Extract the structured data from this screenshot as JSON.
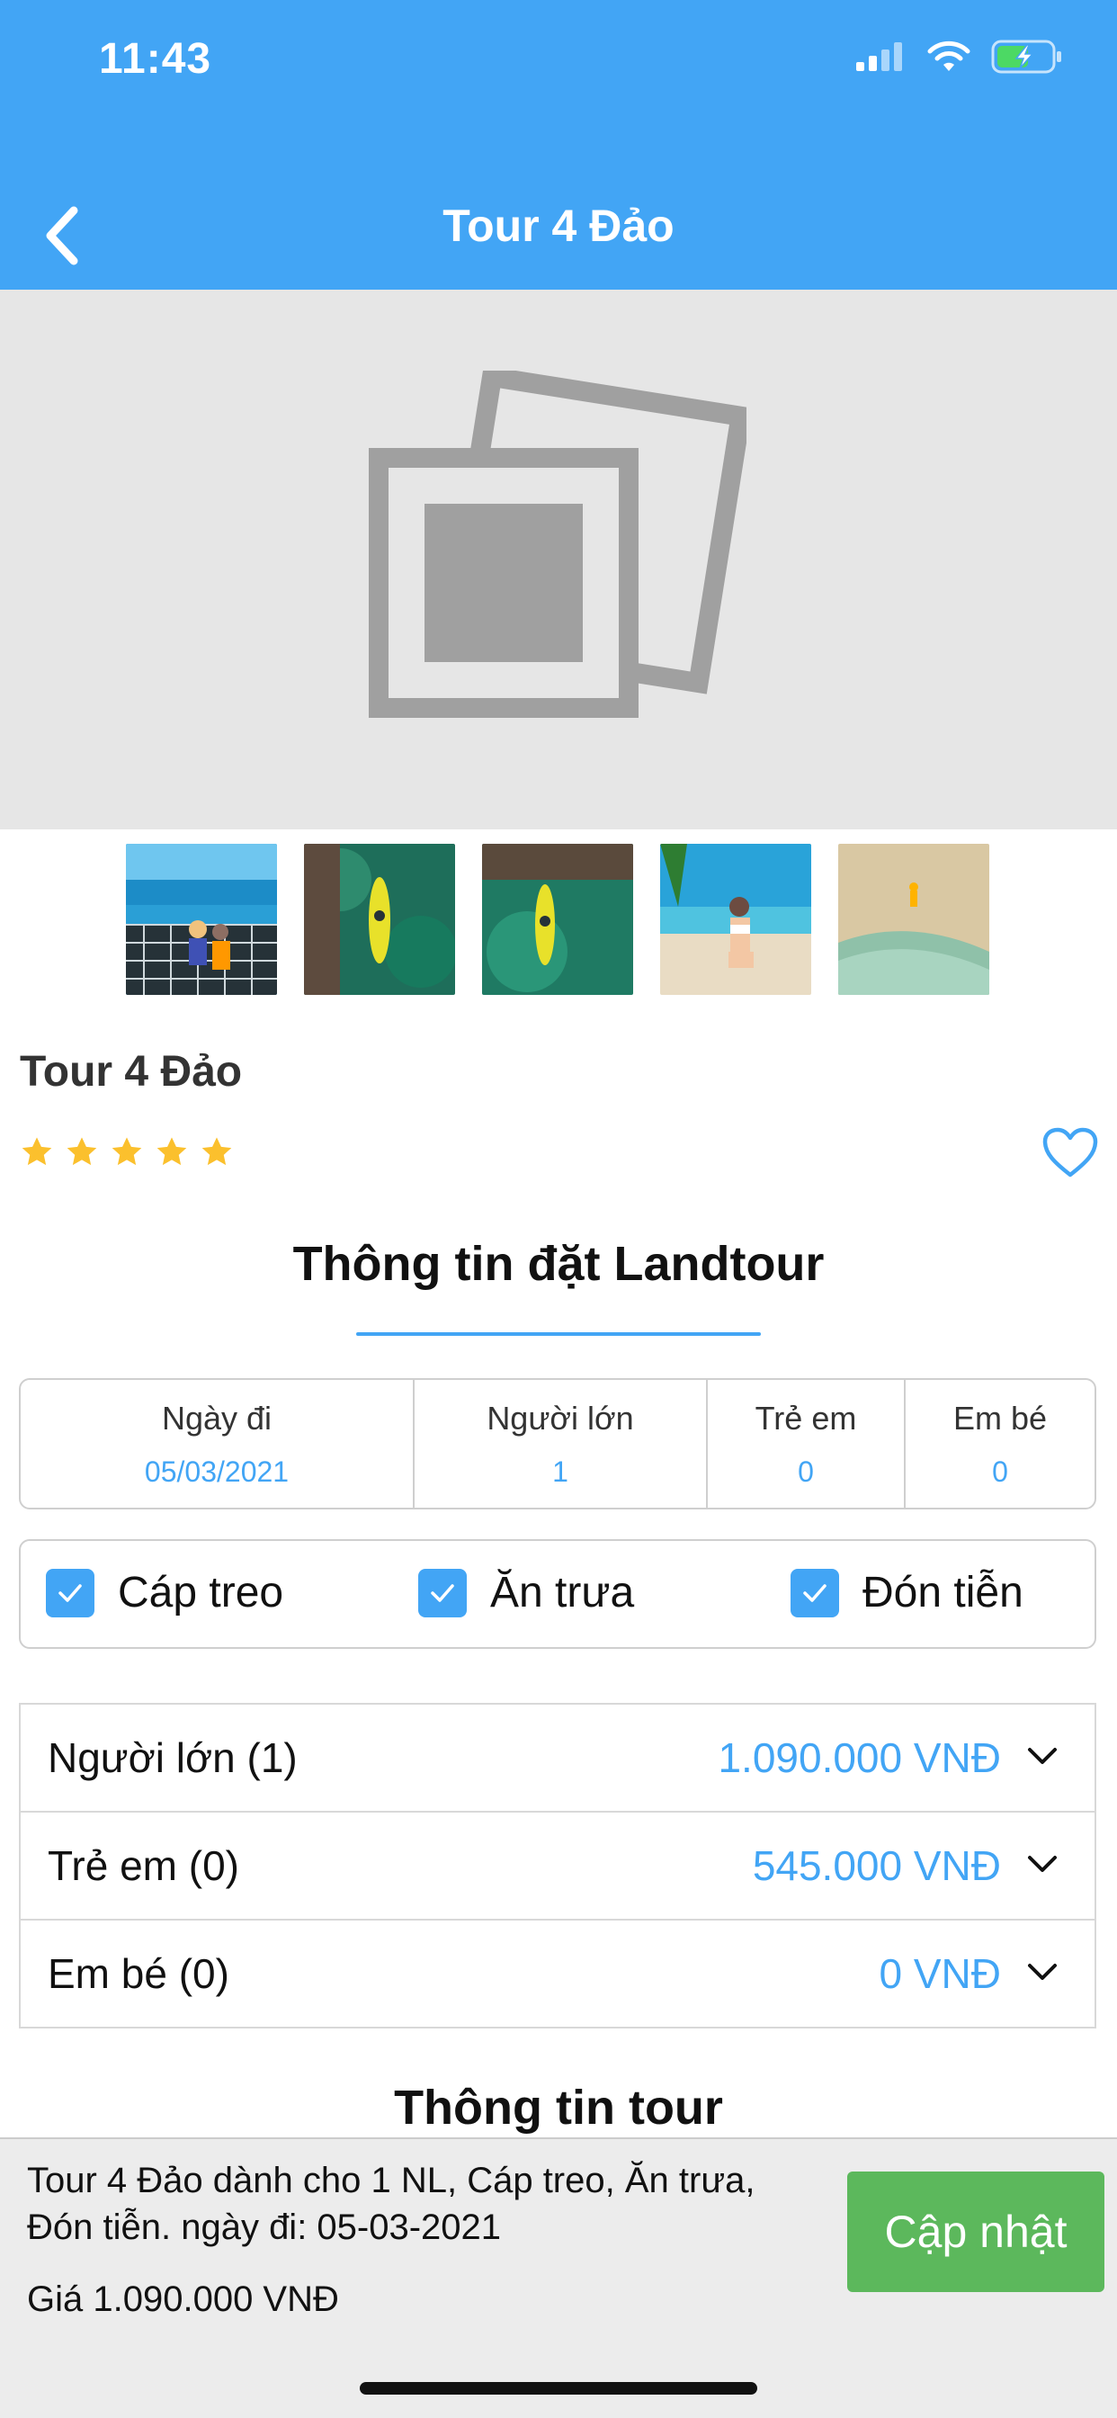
{
  "status_bar": {
    "time": "11:43"
  },
  "header": {
    "title": "Tour 4 Đảo"
  },
  "tour": {
    "name": "Tour 4 Đảo",
    "rating": 5
  },
  "booking": {
    "title": "Thông tin đặt Landtour",
    "fields": [
      {
        "label": "Ngày đi",
        "value": "05/03/2021"
      },
      {
        "label": "Người lớn",
        "value": "1"
      },
      {
        "label": "Trẻ em",
        "value": "0"
      },
      {
        "label": "Em bé",
        "value": "0"
      }
    ],
    "options": [
      {
        "label": "Cáp treo",
        "checked": true
      },
      {
        "label": "Ăn trưa",
        "checked": true
      },
      {
        "label": "Đón tiễn",
        "checked": true
      }
    ],
    "prices": [
      {
        "label": "Người lớn (1)",
        "value": "1.090.000 VNĐ"
      },
      {
        "label": "Trẻ em (0)",
        "value": "545.000 VNĐ"
      },
      {
        "label": "Em bé (0)",
        "value": "0 VNĐ"
      }
    ]
  },
  "tour_info": {
    "title": "Thông tin tour"
  },
  "footer": {
    "description": "Tour 4 Đảo dành cho 1 NL, Cáp treo, Ăn trưa, Đón tiễn. ngày đi: 05-03-2021",
    "price": "Giá 1.090.000 VNĐ",
    "update_label": "Cập nhật"
  },
  "colors": {
    "accent": "#42a5f5",
    "button": "#5cb85c",
    "star": "#fbc02d"
  }
}
